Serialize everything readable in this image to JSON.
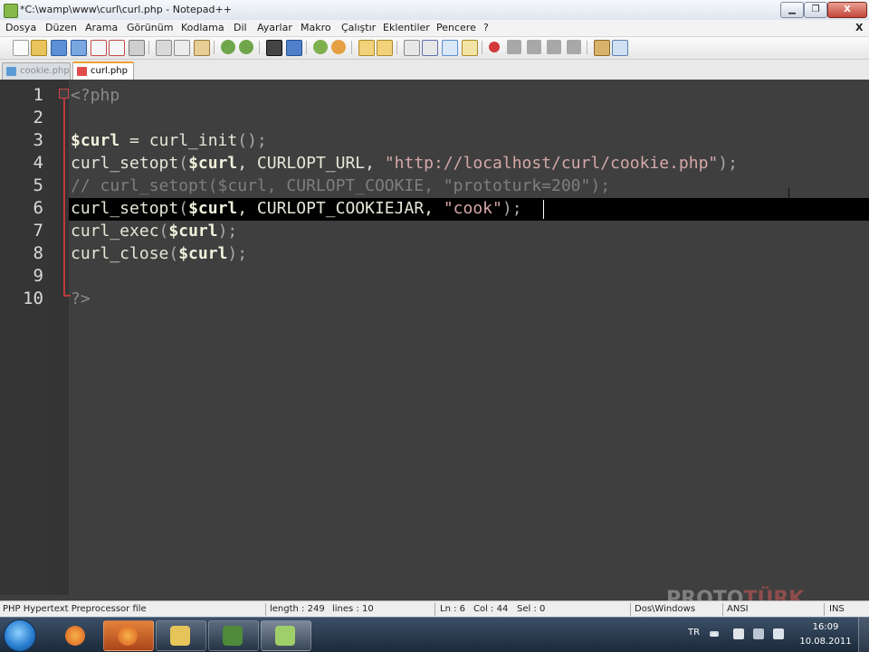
{
  "window": {
    "title": "*C:\\wamp\\www\\curl\\curl.php - Notepad++",
    "min_label": "▁",
    "max_label": "❐",
    "close_label": "X"
  },
  "menu": {
    "items": [
      "Dosya",
      "Düzen",
      "Arama",
      "Görünüm",
      "Kodlama",
      "Dil",
      "Ayarlar",
      "Makro",
      "Çalıştır",
      "Eklentiler",
      "Pencere",
      "?"
    ],
    "doc_close": "X"
  },
  "toolbar": {
    "icons": [
      "new-file",
      "open-file",
      "save",
      "save-all",
      "close",
      "close-all",
      "print",
      "cut",
      "copy",
      "paste",
      "undo",
      "redo",
      "find",
      "replace",
      "zoom-in",
      "zoom-out",
      "sync-vertical",
      "sync-horizontal",
      "word-wrap",
      "show-all-chars",
      "indent-guide",
      "user-lang",
      "record-macro",
      "stop-record",
      "play-macro",
      "run-macro-multiple",
      "save-macro",
      "spell-check",
      "abc-check"
    ]
  },
  "tabs": [
    {
      "label": "cookie.php",
      "active": false,
      "color": "#5b9bd5"
    },
    {
      "label": "curl.php",
      "active": true,
      "color": "#e14b4b"
    }
  ],
  "editor": {
    "line_numbers": [
      "1",
      "2",
      "3",
      "4",
      "5",
      "6",
      "7",
      "8",
      "9",
      "10"
    ],
    "current_line": 6,
    "lines": [
      [
        {
          "t": "<?php",
          "k": "tag"
        }
      ],
      [],
      [
        {
          "t": "$curl",
          "k": "var"
        },
        {
          "t": " = curl_init",
          "k": "plain"
        },
        {
          "t": "();",
          "k": "op"
        }
      ],
      [
        {
          "t": "curl_setopt",
          "k": "plain"
        },
        {
          "t": "(",
          "k": "op"
        },
        {
          "t": "$curl",
          "k": "var"
        },
        {
          "t": ", CURLOPT_URL, ",
          "k": "plain"
        },
        {
          "t": "\"http://localhost/curl/cookie.php\"",
          "k": "str"
        },
        {
          "t": ");",
          "k": "op"
        }
      ],
      [
        {
          "t": "// curl_setopt($curl, CURLOPT_COOKIE, \"prototurk=200\");",
          "k": "com"
        }
      ],
      [
        {
          "t": "curl_setopt",
          "k": "plain"
        },
        {
          "t": "(",
          "k": "op"
        },
        {
          "t": "$curl",
          "k": "var"
        },
        {
          "t": ", CURLOPT_COOKIEJAR, ",
          "k": "plain"
        },
        {
          "t": "\"cook\"",
          "k": "str"
        },
        {
          "t": ");",
          "k": "op"
        }
      ],
      [
        {
          "t": "curl_exec",
          "k": "plain"
        },
        {
          "t": "(",
          "k": "op"
        },
        {
          "t": "$curl",
          "k": "var"
        },
        {
          "t": ");",
          "k": "op"
        }
      ],
      [
        {
          "t": "curl_close",
          "k": "plain"
        },
        {
          "t": "(",
          "k": "op"
        },
        {
          "t": "$curl",
          "k": "var"
        },
        {
          "t": ");",
          "k": "op"
        }
      ],
      [],
      [
        {
          "t": "?>",
          "k": "tag"
        }
      ]
    ]
  },
  "status": {
    "file_type": "PHP Hypertext Preprocessor file",
    "length": "length : 249",
    "lines": "lines : 10",
    "ln": "Ln : 6",
    "col": "Col : 44",
    "sel": "Sel : 0",
    "eol": "Dos\\Windows",
    "encoding": "ANSI",
    "mode": "INS"
  },
  "watermark": {
    "part1": "PROTO",
    "part2": "TÜRK"
  },
  "taskbar": {
    "apps": [
      {
        "name": "firefox",
        "color": "#e8782a"
      },
      {
        "name": "firefox-active",
        "color": "#e8782a"
      },
      {
        "name": "explorer",
        "color": "#e7c45a"
      },
      {
        "name": "camtasia",
        "color": "#4e8a3a"
      },
      {
        "name": "notepad-plus-plus",
        "color": "#9fcf6a"
      }
    ],
    "lang": "TR",
    "time": "16:09",
    "date": "10.08.2011"
  }
}
